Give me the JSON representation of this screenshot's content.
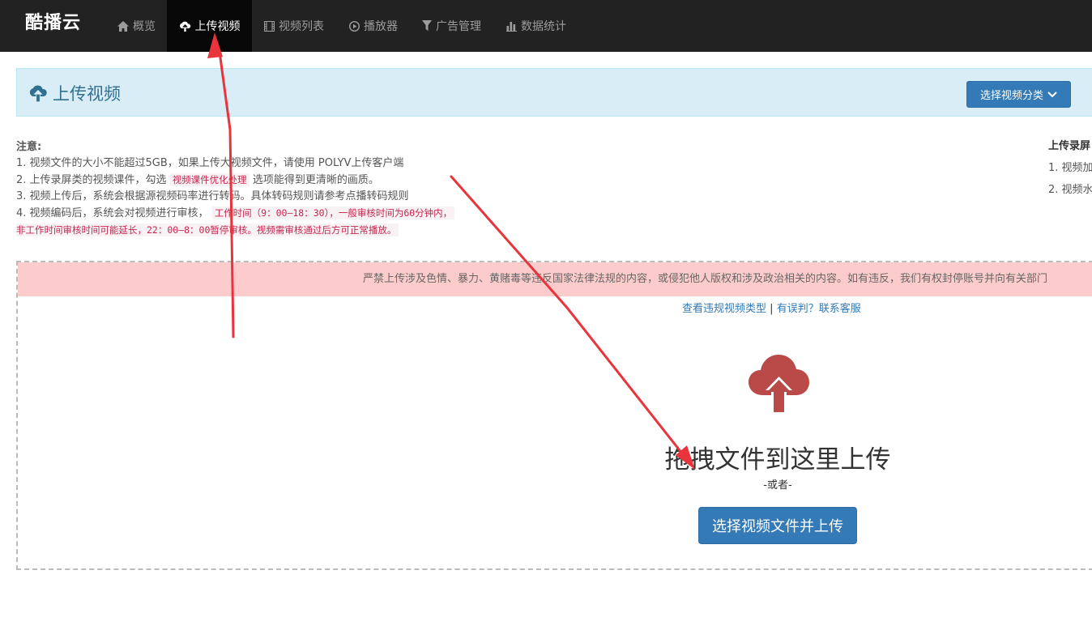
{
  "nav": {
    "brand": "酷播云",
    "items": [
      {
        "label": "概览",
        "icon": "home-icon"
      },
      {
        "label": "上传视频",
        "icon": "cloud-upload-icon"
      },
      {
        "label": "视频列表",
        "icon": "film-icon"
      },
      {
        "label": "播放器",
        "icon": "play-circle-icon"
      },
      {
        "label": "广告管理",
        "icon": "filter-icon"
      },
      {
        "label": "数据统计",
        "icon": "bar-chart-icon"
      }
    ],
    "active_index": 1
  },
  "panel": {
    "title": "上传视频",
    "category_button": "选择视频分类"
  },
  "notes": {
    "heading": "注意:",
    "line1": "1. 视频文件的大小不能超过5GB，如果上传大视频文件，请使用 POLYV上传客户端",
    "line2_prefix": "2. 上传录屏类的视频课件，勾选",
    "line2_code": "视频课件优化处理",
    "line2_suffix": "选项能得到更清晰的画质。",
    "line3": "3. 视频上传后，系统会根据源视频码率进行转码。具体转码规则请参考点播转码规则",
    "line4_prefix": "4. 视频编码后，系统会对视频进行审核，",
    "line4_code": "工作时间（9：00—18：30），一般审核时间为60分钟内，",
    "line5_code": "非工作时间审核时间可能延长，22：00—8：00暂停审核。视频需审核通过后方可正常播放。"
  },
  "side_notes": {
    "heading": "上传录屏",
    "line1": "1. 视频加",
    "line2": "2. 视频水"
  },
  "upload": {
    "warning": "严禁上传涉及色情、暴力、黄赌毒等违反国家法律法规的内容，或侵犯他人版权和涉及政治相关的内容。如有违反，我们有权封停账号并向有关部门",
    "link_types": "查看违规视频类型",
    "link_separator": "|",
    "link_contact": "有误判？联系客服",
    "drag_text": "拖拽文件到这里上传",
    "or_text": "-或者-",
    "upload_button": "选择视频文件并上传"
  },
  "colors": {
    "navbar": "#222222",
    "primary": "#337ab7",
    "panel_bg": "#d9edf7",
    "warning_bg": "#fccccc",
    "cloud_icon": "#b94a48",
    "annotation_arrow": "#e8343a"
  }
}
